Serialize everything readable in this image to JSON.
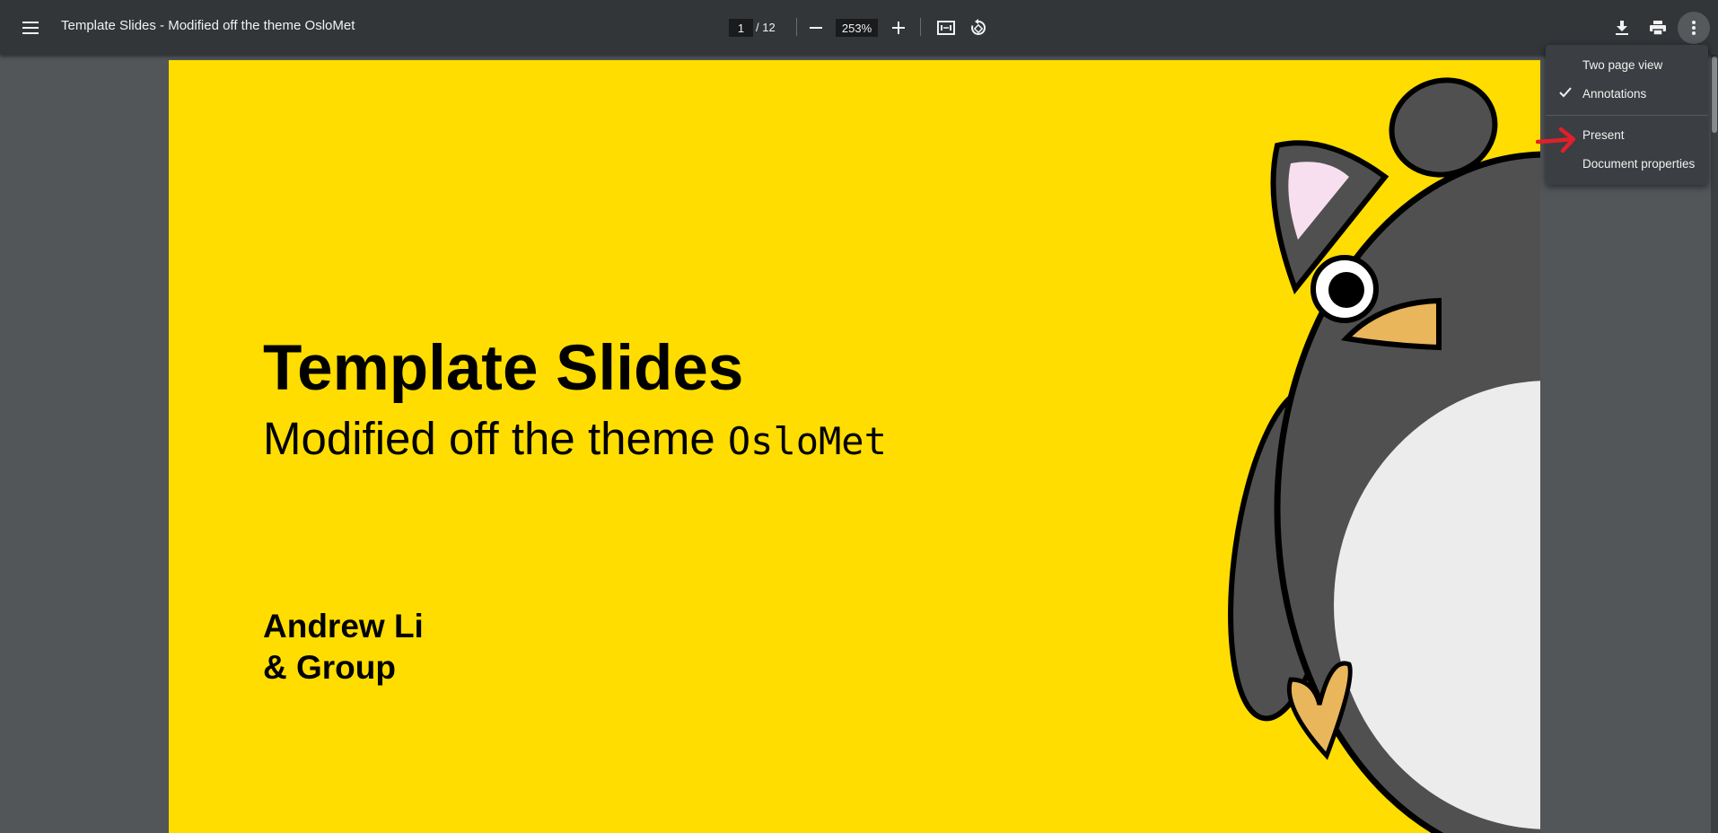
{
  "toolbar": {
    "title": "Template Slides - Modified off the theme OsloMet",
    "page_current": "1",
    "page_total": "/ 12",
    "zoom": "253%"
  },
  "slide": {
    "title": "Template Slides",
    "subtitle_text": "Modified off the theme ",
    "subtitle_mono": "OsloMet",
    "author_line1": "Andrew Li",
    "author_line2": "& Group"
  },
  "menu": {
    "items": [
      {
        "label": "Two page view",
        "checked": false
      },
      {
        "label": "Annotations",
        "checked": true
      },
      {
        "label": "Present",
        "checked": false
      },
      {
        "label": "Document properties",
        "checked": false
      }
    ]
  },
  "colors": {
    "toolbar_bg": "#323639",
    "viewer_bg": "#525659",
    "slide_bg": "#ffdd00",
    "annotation_red": "#e0202a"
  },
  "icons": [
    "menu-icon",
    "zoom-out-icon",
    "zoom-in-icon",
    "fit-page-icon",
    "rotate-icon",
    "download-icon",
    "print-icon",
    "more-vert-icon",
    "checkmark-icon"
  ]
}
